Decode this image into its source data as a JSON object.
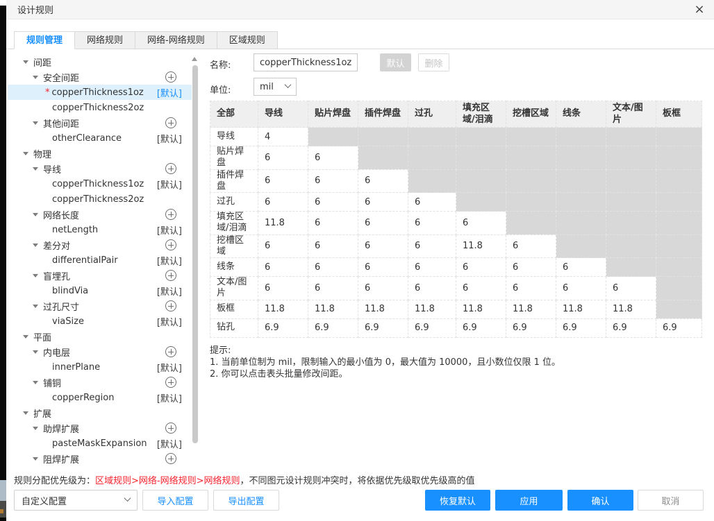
{
  "colors": {
    "accent": "#1890ff",
    "danger": "#f5222d",
    "header-bg": "#efefef",
    "blocked": "#d8d8d8",
    "selected-bg": "#ddf0fb"
  },
  "dialog": {
    "title": "设计规则",
    "close_icon": "×"
  },
  "tabs": [
    {
      "name": "tab-rule-management",
      "label": "规则管理",
      "active": true
    },
    {
      "name": "tab-net-rules",
      "label": "网络规则",
      "active": false
    },
    {
      "name": "tab-net-net-rules",
      "label": "网络-网络规则",
      "active": false
    },
    {
      "name": "tab-region-rules",
      "label": "区域规则",
      "active": false
    }
  ],
  "tree": {
    "star_char": "*",
    "items": [
      {
        "label": "间距",
        "level": 1,
        "expandable": true
      },
      {
        "label": "安全间距",
        "level": 2,
        "expandable": true,
        "add": true
      },
      {
        "label": "copperThickness1oz",
        "level": 3,
        "selected": true,
        "star": true,
        "badge": "[默认]"
      },
      {
        "label": "copperThickness2oz",
        "level": 3
      },
      {
        "label": "其他间距",
        "level": 2,
        "expandable": true,
        "add": true
      },
      {
        "label": "otherClearance",
        "level": 3,
        "badge": "[默认]"
      },
      {
        "label": "物理",
        "level": 1,
        "expandable": true
      },
      {
        "label": "导线",
        "level": 2,
        "expandable": true,
        "add": true
      },
      {
        "label": "copperThickness1oz",
        "level": 3,
        "badge": "[默认]"
      },
      {
        "label": "copperThickness2oz",
        "level": 3
      },
      {
        "label": "网络长度",
        "level": 2,
        "expandable": true,
        "add": true
      },
      {
        "label": "netLength",
        "level": 3,
        "badge": "[默认]"
      },
      {
        "label": "差分对",
        "level": 2,
        "expandable": true,
        "add": true
      },
      {
        "label": "differentialPair",
        "level": 3,
        "badge": "[默认]"
      },
      {
        "label": "盲埋孔",
        "level": 2,
        "expandable": true,
        "add": true
      },
      {
        "label": "blindVia",
        "level": 3,
        "badge": "[默认]"
      },
      {
        "label": "过孔尺寸",
        "level": 2,
        "expandable": true,
        "add": true
      },
      {
        "label": "viaSize",
        "level": 3,
        "badge": "[默认]"
      },
      {
        "label": "平面",
        "level": 1,
        "expandable": true
      },
      {
        "label": "内电层",
        "level": 2,
        "expandable": true,
        "add": true
      },
      {
        "label": "innerPlane",
        "level": 3,
        "badge": "[默认]"
      },
      {
        "label": "铺铜",
        "level": 2,
        "expandable": true,
        "add": true
      },
      {
        "label": "copperRegion",
        "level": 3,
        "badge": "[默认]"
      },
      {
        "label": "扩展",
        "level": 1,
        "expandable": true
      },
      {
        "label": "助焊扩展",
        "level": 2,
        "expandable": true,
        "add": true
      },
      {
        "label": "pasteMaskExpansion",
        "level": 3,
        "badge": "[默认]"
      },
      {
        "label": "阻焊扩展",
        "level": 2,
        "expandable": true,
        "add": true
      }
    ]
  },
  "form": {
    "name_label": "名称:",
    "name_value": "copperThickness1oz",
    "default_button": "默认",
    "delete_button": "删除",
    "unit_label": "单位:",
    "unit_value": "mil"
  },
  "matrix": {
    "columns": [
      "全部",
      "导线",
      "贴片焊盘",
      "插件焊盘",
      "过孔",
      "填充区域/泪滴",
      "挖槽区域",
      "线条",
      "文本/图片",
      "板框"
    ],
    "rows": [
      {
        "label": "导线",
        "values": [
          "4"
        ]
      },
      {
        "label": "贴片焊盘",
        "values": [
          "6",
          "6"
        ]
      },
      {
        "label": "插件焊盘",
        "values": [
          "6",
          "6",
          "6"
        ]
      },
      {
        "label": "过孔",
        "values": [
          "6",
          "6",
          "6",
          "6"
        ]
      },
      {
        "label": "填充区域/泪滴",
        "values": [
          "11.8",
          "6",
          "6",
          "6",
          "6"
        ]
      },
      {
        "label": "挖槽区域",
        "values": [
          "6",
          "6",
          "6",
          "6",
          "11.8",
          "6"
        ]
      },
      {
        "label": "线条",
        "values": [
          "6",
          "6",
          "6",
          "6",
          "6",
          "6",
          "6"
        ]
      },
      {
        "label": "文本/图片",
        "values": [
          "6",
          "6",
          "6",
          "6",
          "6",
          "6",
          "6",
          "6"
        ]
      },
      {
        "label": "板框",
        "values": [
          "11.8",
          "11.8",
          "11.8",
          "11.8",
          "11.8",
          "11.8",
          "11.8",
          "11.8"
        ]
      },
      {
        "label": "钻孔",
        "values": [
          "6.9",
          "6.9",
          "6.9",
          "6.9",
          "6.9",
          "6.9",
          "6.9",
          "6.9",
          "6.9"
        ]
      }
    ]
  },
  "hints": {
    "title": "提示:",
    "lines": [
      "1. 当前单位制为 mil，限制输入的最小值为 0，最大值为 10000，且小数位仅限 1 位。",
      "2. 你可以点击表头批量修改间距。"
    ]
  },
  "footer": {
    "priority_prefix": "规则分配优先级为：",
    "priority_red": "区域规则>网络-网络规则>网络规则",
    "priority_suffix": "，不同图元设计规则冲突时，将依据优先级取优先级高的值",
    "config_select": "自定义配置",
    "import_button": "导入配置",
    "export_button": "导出配置",
    "restore_button": "恢复默认",
    "apply_button": "应用",
    "confirm_button": "确认",
    "cancel_button": "取消"
  }
}
